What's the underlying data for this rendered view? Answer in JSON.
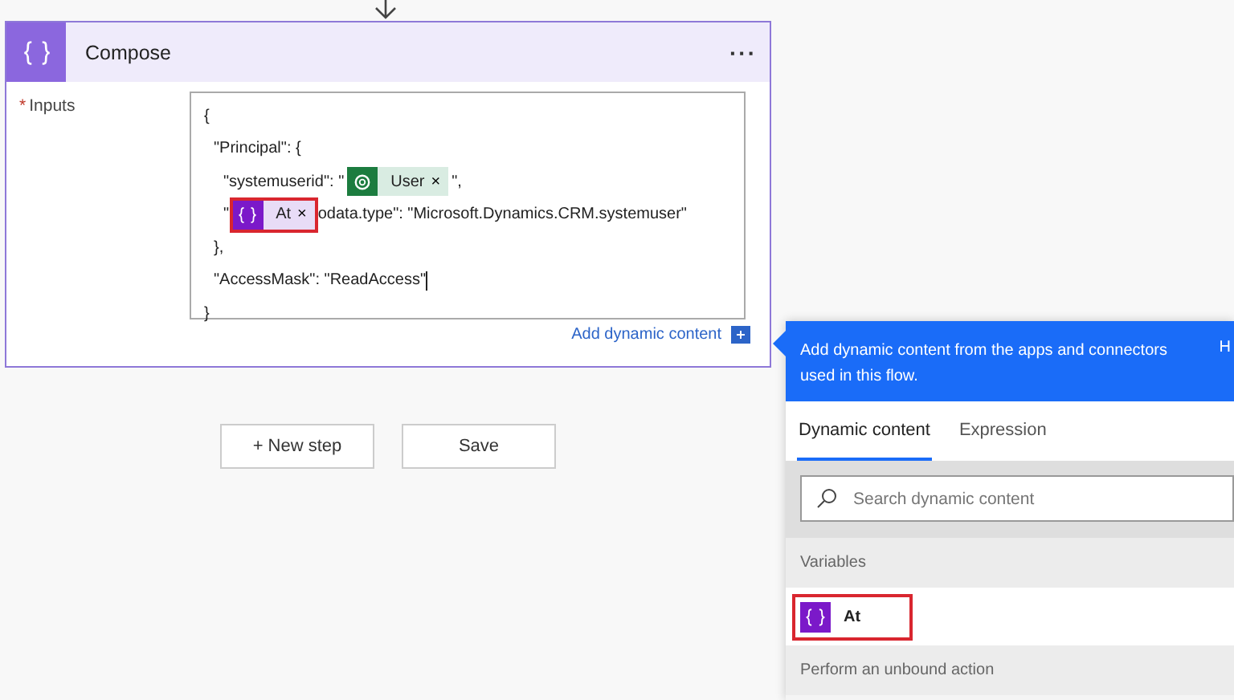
{
  "card": {
    "title": "Compose",
    "menu": "···",
    "field_label": "Inputs",
    "required_mark": "*",
    "editor": {
      "lines": [
        {
          "segments": [
            {
              "kind": "text",
              "text": "{"
            }
          ],
          "children": [
            {
              "segments": [
                {
                  "kind": "text",
                  "text": "\"Principal\": {"
                }
              ],
              "children": [
                {
                  "segments": [
                    {
                      "kind": "text",
                      "text": "\"systemuserid\": \""
                    },
                    {
                      "kind": "dataverse_token",
                      "label": "User",
                      "remove": "×",
                      "highlighted": false
                    },
                    {
                      "kind": "text",
                      "text": "\","
                    }
                  ]
                },
                {
                  "segments": [
                    {
                      "kind": "text",
                      "text": "\""
                    },
                    {
                      "kind": "variable_token",
                      "label": "At",
                      "remove": "×",
                      "highlighted": true
                    },
                    {
                      "kind": "text",
                      "text": "odata.type\": \"Microsoft.Dynamics.CRM.systemuser\""
                    }
                  ]
                }
              ]
            },
            {
              "segments": [
                {
                  "kind": "text",
                  "text": "},"
                }
              ]
            },
            {
              "segments": [
                {
                  "kind": "text",
                  "text": "\"AccessMask\": \"ReadAccess\""
                },
                {
                  "kind": "cursor"
                }
              ]
            }
          ]
        },
        {
          "segments": [
            {
              "kind": "text",
              "text": "}"
            }
          ]
        }
      ]
    },
    "add_dynamic": "Add dynamic content"
  },
  "buttons": [
    {
      "label": "+ New step"
    },
    {
      "label": "Save"
    }
  ],
  "panel": {
    "banner": "Add dynamic content from the apps and connectors used in this flow.",
    "banner_cut": "H",
    "tabs": [
      {
        "label": "Dynamic content",
        "selected": true
      },
      {
        "label": "Expression",
        "selected": false
      }
    ],
    "search": {
      "placeholder": "Search dynamic content"
    },
    "sections": [
      {
        "title": "Variables",
        "items": [
          {
            "label": "At",
            "highlighted": true
          }
        ]
      },
      {
        "title": "Perform an unbound action"
      }
    ]
  }
}
